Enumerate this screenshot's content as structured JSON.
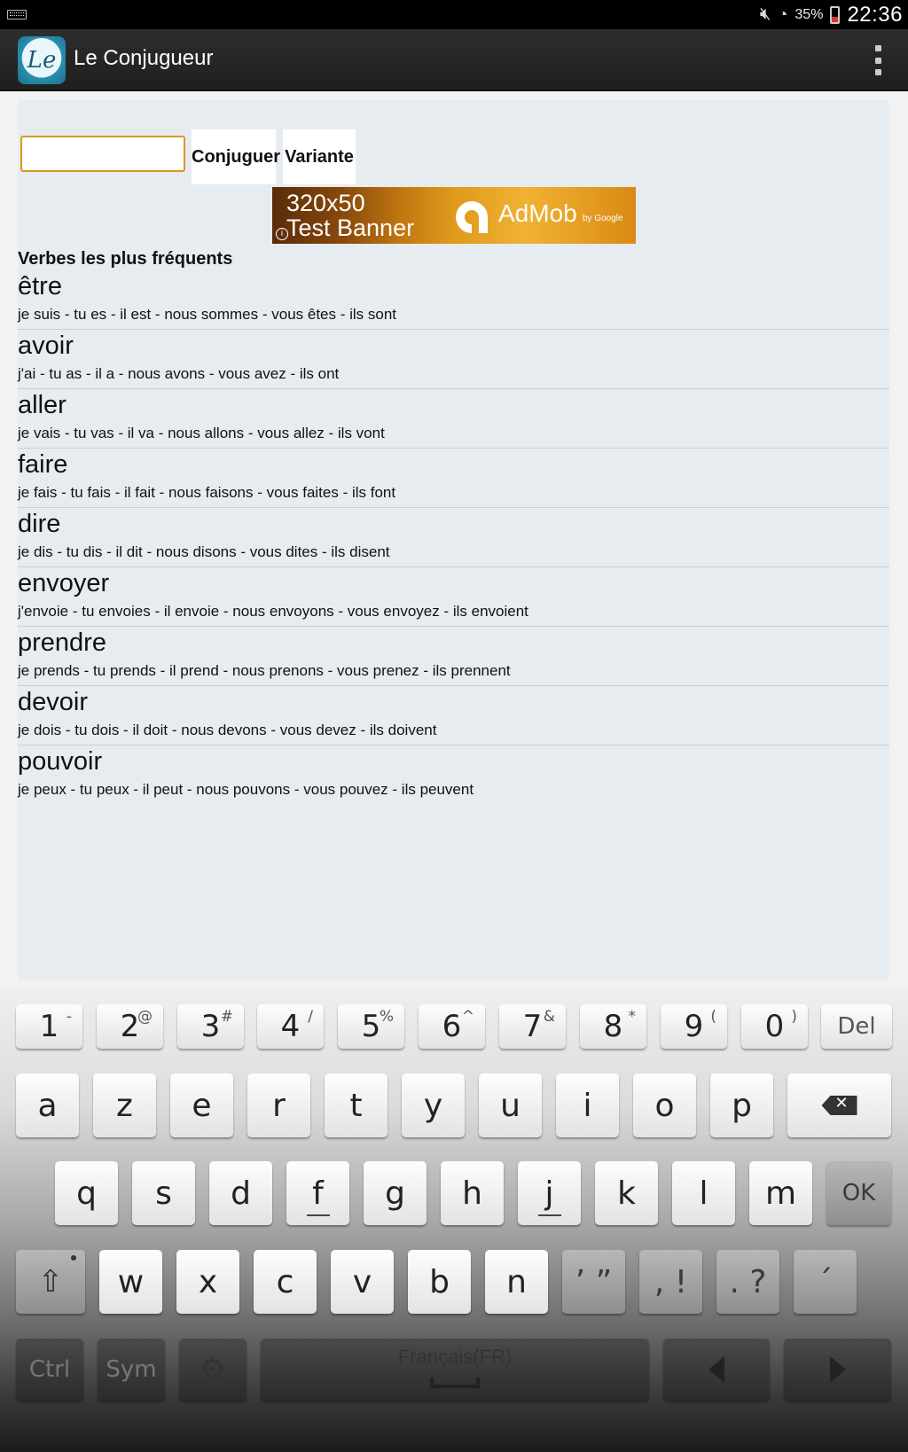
{
  "status_bar": {
    "battery": "35%",
    "time": "22:36"
  },
  "app_bar": {
    "icon_text": "Le",
    "title": "Le Conjugueur"
  },
  "search": {
    "value": "",
    "conjugate_label": "Conjuguer",
    "variant_label": "Variante"
  },
  "ad": {
    "size_label": "320x50",
    "banner_label": "Test Banner",
    "brand": "AdMob",
    "by": "by Google"
  },
  "section_title": "Verbes les plus fréquents",
  "verbs": [
    {
      "name": "être",
      "forms": "je suis - tu es - il est - nous sommes - vous êtes - ils sont"
    },
    {
      "name": "avoir",
      "forms": "j'ai - tu as - il a - nous avons - vous avez - ils ont"
    },
    {
      "name": "aller",
      "forms": "je vais - tu vas - il va - nous allons - vous allez - ils vont"
    },
    {
      "name": "faire",
      "forms": "je fais - tu fais - il fait - nous faisons - vous faites - ils font"
    },
    {
      "name": "dire",
      "forms": "je dis - tu dis - il dit - nous disons - vous dites - ils disent"
    },
    {
      "name": "envoyer",
      "forms": "j'envoie - tu envoies - il envoie - nous envoyons - vous envoyez - ils envoient"
    },
    {
      "name": "prendre",
      "forms": "je prends - tu prends - il prend - nous prenons - vous prenez - ils prennent"
    },
    {
      "name": "devoir",
      "forms": "je dois - tu dois - il doit - nous devons - vous devez - ils doivent"
    },
    {
      "name": "pouvoir",
      "forms": "je peux - tu peux - il peut - nous pouvons - vous pouvez - ils peuvent"
    }
  ],
  "keyboard": {
    "number_row": [
      {
        "main": "1",
        "sup": "-"
      },
      {
        "main": "2",
        "sup": "@"
      },
      {
        "main": "3",
        "sup": "#"
      },
      {
        "main": "4",
        "sup": "/"
      },
      {
        "main": "5",
        "sup": "%"
      },
      {
        "main": "6",
        "sup": "^"
      },
      {
        "main": "7",
        "sup": "&"
      },
      {
        "main": "8",
        "sup": "*"
      },
      {
        "main": "9",
        "sup": "("
      },
      {
        "main": "0",
        "sup": ")"
      }
    ],
    "del_label": "Del",
    "row1": [
      "a",
      "z",
      "e",
      "r",
      "t",
      "y",
      "u",
      "i",
      "o",
      "p"
    ],
    "row2": [
      "q",
      "s",
      "d",
      "f",
      "g",
      "h",
      "j",
      "k",
      "l",
      "m"
    ],
    "ok_label": "OK",
    "row3": [
      "w",
      "x",
      "c",
      "v",
      "b",
      "n",
      "’ ”",
      ", !",
      ". ?",
      "´"
    ],
    "ctrl_label": "Ctrl",
    "sym_label": "Sym",
    "language": "Français(FR)"
  }
}
